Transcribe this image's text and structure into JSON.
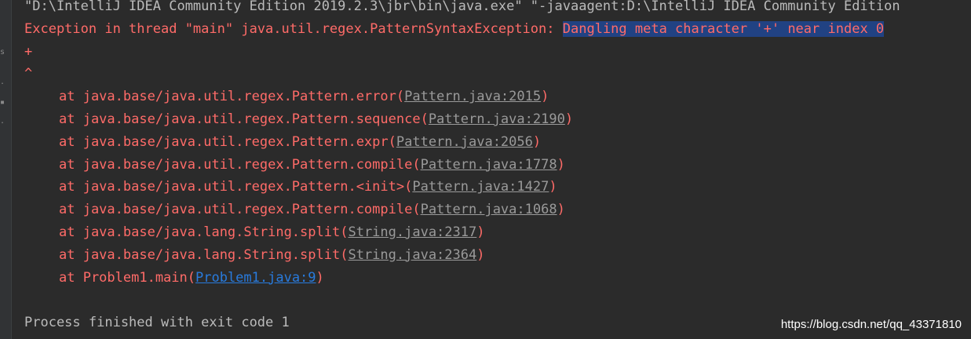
{
  "command_line": "\"D:\\IntelliJ IDEA Community Edition 2019.2.3\\jbr\\bin\\java.exe\" \"-javaagent:D:\\IntelliJ IDEA Community Edition",
  "exception": {
    "prefix": "Exception in thread \"main\" java.util.regex.PatternSyntaxException: ",
    "message": "Dangling meta character '+' near index 0",
    "pattern_line": "+",
    "caret_line": "^"
  },
  "stack": [
    {
      "method": "at java.base/java.util.regex.Pattern.error(",
      "link": "Pattern.java:2015",
      "end": ")"
    },
    {
      "method": "at java.base/java.util.regex.Pattern.sequence(",
      "link": "Pattern.java:2190",
      "end": ")"
    },
    {
      "method": "at java.base/java.util.regex.Pattern.expr(",
      "link": "Pattern.java:2056",
      "end": ")"
    },
    {
      "method": "at java.base/java.util.regex.Pattern.compile(",
      "link": "Pattern.java:1778",
      "end": ")"
    },
    {
      "method": "at java.base/java.util.regex.Pattern.<init>(",
      "link": "Pattern.java:1427",
      "end": ")"
    },
    {
      "method": "at java.base/java.util.regex.Pattern.compile(",
      "link": "Pattern.java:1068",
      "end": ")"
    },
    {
      "method": "at java.base/java.lang.String.split(",
      "link": "String.java:2317",
      "end": ")"
    },
    {
      "method": "at java.base/java.lang.String.split(",
      "link": "String.java:2364",
      "end": ")"
    },
    {
      "method": "at Problem1.main(",
      "link": "Problem1.java:9",
      "end": ")"
    }
  ],
  "exit_line": "Process finished with exit code 1",
  "watermark": "https://blog.csdn.net/qq_43371810",
  "colors": {
    "background": "#2b2b2b",
    "error_text": "#ff6b68",
    "selection": "#214283",
    "user_link": "#287bde"
  }
}
